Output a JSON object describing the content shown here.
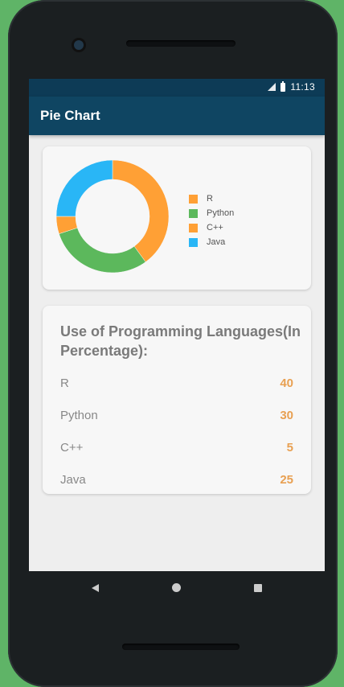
{
  "status": {
    "time": "11:13"
  },
  "appbar": {
    "title": "Pie Chart"
  },
  "chart_data": {
    "type": "pie",
    "categories": [
      "R",
      "Python",
      "C++",
      "Java"
    ],
    "values": [
      40,
      30,
      5,
      25
    ],
    "colors": [
      "#ffa035",
      "#5cb85c",
      "#ffa035",
      "#29b6f6"
    ]
  },
  "legend": [
    {
      "label": "R",
      "color": "#ffa035"
    },
    {
      "label": "Python",
      "color": "#5cb85c"
    },
    {
      "label": "C++",
      "color": "#ffa035"
    },
    {
      "label": "Java",
      "color": "#29b6f6"
    }
  ],
  "table": {
    "title": "Use of Programming Languages(In Percentage):",
    "rows": [
      {
        "name": "R",
        "value": "40"
      },
      {
        "name": "Python",
        "value": "30"
      },
      {
        "name": "C++",
        "value": "5"
      },
      {
        "name": "Java",
        "value": "25"
      }
    ]
  },
  "nav": {
    "back_icon": "back-triangle-icon",
    "home_icon": "home-circle-icon",
    "recents_icon": "recents-square-icon"
  }
}
